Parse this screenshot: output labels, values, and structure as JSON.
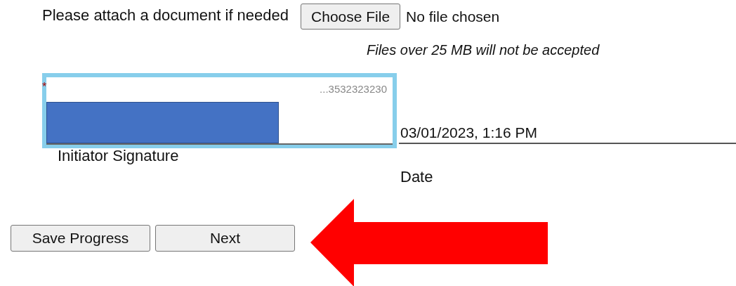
{
  "attachment": {
    "label": "Please attach a document if needed",
    "button": "Choose File",
    "status": "No file chosen",
    "note": "Files over 25 MB will not be accepted"
  },
  "signature": {
    "required_mark": "*",
    "id": "...3532323230",
    "caption": "Initiator Signature"
  },
  "date": {
    "value": "03/01/2023, 1:16 PM",
    "caption": "Date"
  },
  "buttons": [
    "Save Progress",
    "Next"
  ]
}
